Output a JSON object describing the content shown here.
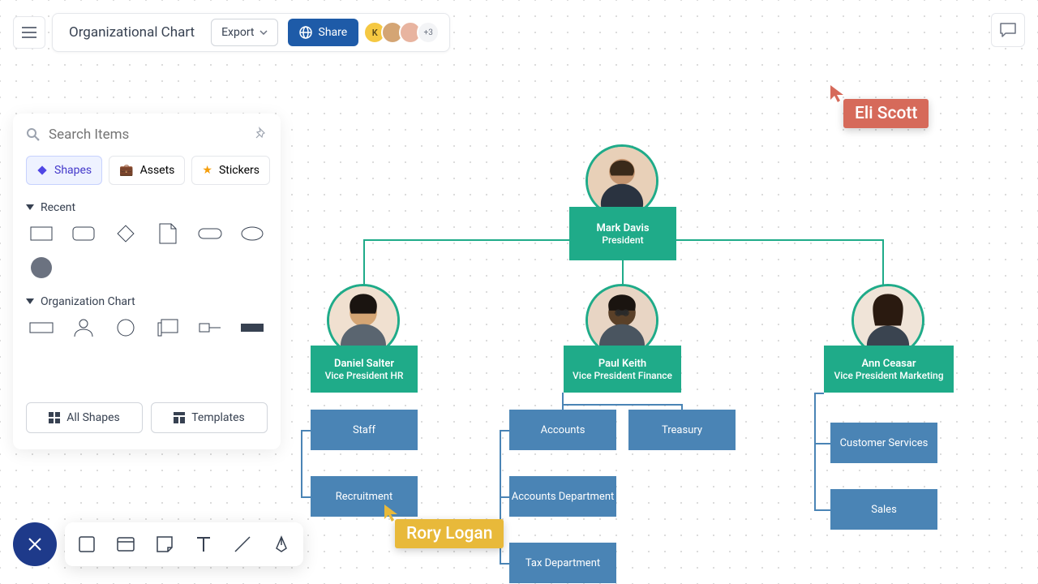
{
  "header": {
    "title": "Organizational Chart",
    "export": "Export",
    "share": "Share",
    "more_count": "+3",
    "avatar_k": "K"
  },
  "sidebar": {
    "search_placeholder": "Search Items",
    "tabs": {
      "shapes": "Shapes",
      "assets": "Assets",
      "stickers": "Stickers"
    },
    "sections": {
      "recent": "Recent",
      "org": "Organization Chart"
    },
    "buttons": {
      "all_shapes": "All Shapes",
      "templates": "Templates"
    }
  },
  "chart_data": {
    "type": "org_chart",
    "root": {
      "name": "Mark Davis",
      "role": "President"
    },
    "children": [
      {
        "name": "Daniel Salter",
        "role": "Vice President HR",
        "children": [
          {
            "label": "Staff"
          },
          {
            "label": "Recruitment"
          }
        ]
      },
      {
        "name": "Paul Keith",
        "role": "Vice President Finance",
        "children": [
          {
            "label": "Accounts"
          },
          {
            "label": "Treasury"
          },
          {
            "label": "Accounts Department"
          },
          {
            "label": "Tax Department"
          }
        ]
      },
      {
        "name": "Ann Ceasar",
        "role": "Vice President Marketing",
        "children": [
          {
            "label": "Customer Services"
          },
          {
            "label": "Sales"
          }
        ]
      }
    ]
  },
  "collaborators": {
    "c1": "Eli Scott",
    "c2": "Rory Logan"
  }
}
